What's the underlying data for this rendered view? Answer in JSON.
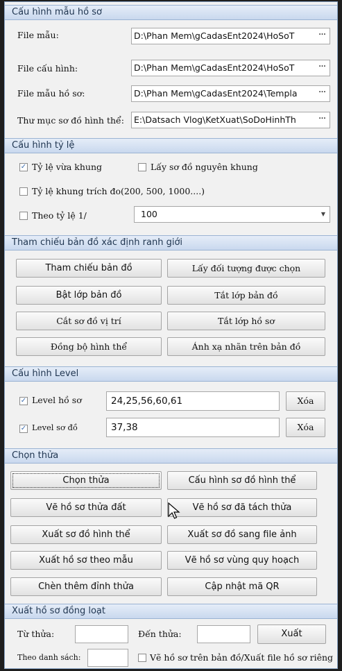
{
  "sections": {
    "template": "Cấu hình mẫu hồ sơ",
    "scale": "Cấu hình tỷ lệ",
    "reference": "Tham chiếu bản đồ xác định ranh giới",
    "level": "Cấu hình Level",
    "select_parcel": "Chọn thửa",
    "batch": "Xuất hồ sơ đồng loạt"
  },
  "template": {
    "file_mau_label": "File mẫu:",
    "file_mau_value": "D:\\Phan Mem\\gCadasEnt2024\\HoSoT",
    "file_cau_hinh_label": "File cấu hình:",
    "file_cau_hinh_value": "D:\\Phan Mem\\gCadasEnt2024\\HoSoT",
    "file_mau_ho_so_label": "File mẫu hồ sơ:",
    "file_mau_ho_so_value": "D:\\Phan Mem\\gCadasEnt2024\\Templa",
    "thu_muc_label": "Thư mục sơ đồ hình thể:",
    "thu_muc_value": "E:\\Datsach Vlog\\KetXuat\\SoDoHinhTh",
    "browse": "···"
  },
  "scale": {
    "fit_frame_label": "Tỷ lệ vừa khung",
    "fit_frame_checked": true,
    "original_frame_label": "Lấy sơ đồ nguyên khung",
    "original_frame_checked": false,
    "extract_frame_label": "Tỷ lệ khung trích đo(200, 500, 1000....)",
    "extract_frame_checked": false,
    "ratio_label": "Theo tỷ lệ 1/",
    "ratio_checked": false,
    "ratio_value": "100",
    "combo_arrow": "▼"
  },
  "reference": {
    "btn_ref_map": "Tham chiếu bản đồ",
    "btn_get_selected": "Lấy đối tượng được chọn",
    "btn_layer_on": "Bật lớp bản đồ",
    "btn_layer_off": "Tắt lớp bản đồ",
    "btn_cut_location": "Cắt sơ đồ vị trí",
    "btn_profile_off": "Tắt lớp hồ sơ",
    "btn_sync_shape": "Đồng bộ hình thể",
    "btn_map_labels": "Ánh xạ nhãn trên bản đồ"
  },
  "level": {
    "profile_label": "Level hồ sơ",
    "profile_checked": true,
    "profile_value": "24,25,56,60,61",
    "diagram_label": "Level sơ đồ",
    "diagram_checked": true,
    "diagram_value": "37,38",
    "delete": "Xóa"
  },
  "select_parcel": {
    "btn_select": "Chọn thửa",
    "btn_config_shape": "Cấu hình sơ đồ hình thể",
    "btn_draw_land": "Vẽ hồ sơ thửa đất",
    "btn_draw_split": "Vẽ hồ sơ đã tách thửa",
    "btn_export_shape": "Xuất sơ đồ hình thể",
    "btn_export_image": "Xuất sơ đồ sang file ảnh",
    "btn_export_template": "Xuất hồ sơ theo mẫu",
    "btn_draw_planning": "Vẽ hồ sơ vùng quy hoạch",
    "btn_insert_vertex": "Chèn thêm đỉnh thửa",
    "btn_update_qr": "Cập nhật mã QR"
  },
  "batch": {
    "from_label": "Từ thửa:",
    "from_value": "",
    "to_label": "Đến thửa:",
    "to_value": "",
    "export": "Xuất",
    "list_label": "Theo danh sách:",
    "list_value": "",
    "draw_on_map_label": "Vẽ hồ sơ trên bản đồ/Xuất file hồ sơ riêng",
    "draw_on_map_checked": false
  }
}
